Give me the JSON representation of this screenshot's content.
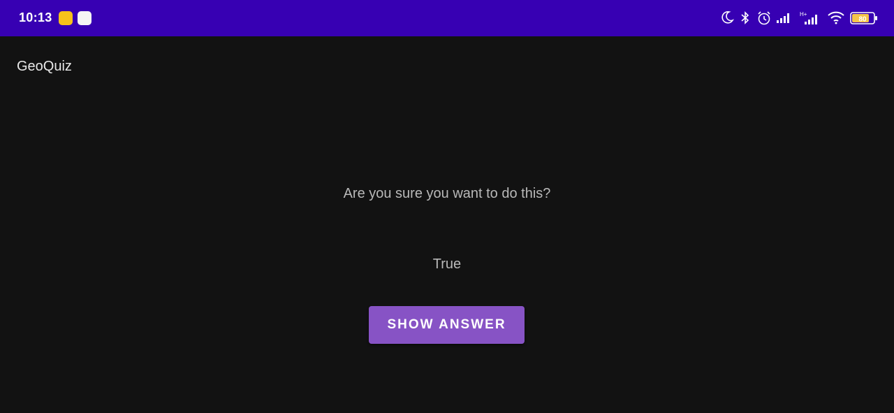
{
  "status_bar": {
    "time": "10:13",
    "battery_level": "80",
    "background_color": "#3700b3",
    "left_icons": [
      "app-notification-icon",
      "qr-notification-icon"
    ],
    "right_icons": [
      "moon-icon",
      "bluetooth-icon",
      "alarm-icon",
      "signal-icon",
      "signal-hd-icon",
      "wifi-icon",
      "battery-icon"
    ]
  },
  "app_bar": {
    "title": "GeoQuiz"
  },
  "main": {
    "question": "Are you sure you want to do this?",
    "answer": "True",
    "show_answer_label": "Show Answer"
  },
  "colors": {
    "background": "#121212",
    "button": "#8753c5",
    "text_secondary": "#b9b9b9"
  }
}
